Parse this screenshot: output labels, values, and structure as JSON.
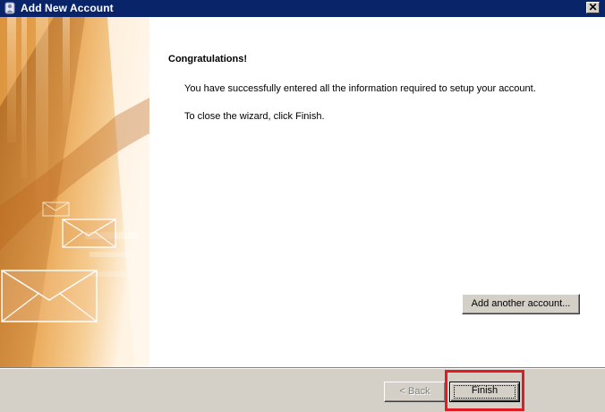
{
  "window": {
    "title": "Add New Account",
    "close_glyph": "✕",
    "icon": "outlook-account-icon"
  },
  "content": {
    "heading": "Congratulations!",
    "message_1": "You have successfully entered all the information required to setup your account.",
    "message_2": "To close the wizard, click Finish.",
    "add_another_label": "Add another account..."
  },
  "footer": {
    "back_label": "< Back",
    "finish_label": "Finish"
  },
  "colors": {
    "title_bar": "#0a246a",
    "dialog_face": "#d4d0c8",
    "highlight": "#e01b24"
  }
}
